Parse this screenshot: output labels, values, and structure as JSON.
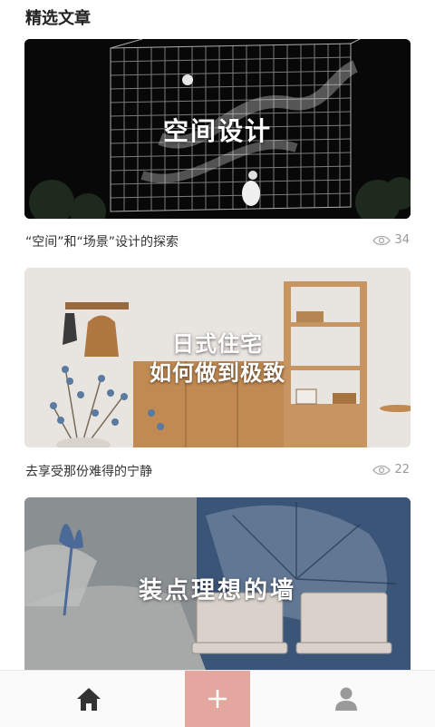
{
  "header": {
    "title": "精选文章"
  },
  "articles": [
    {
      "overlay_lines": [
        "空间设计"
      ],
      "title": "“空间”和“场景”设计的探索",
      "views": "34"
    },
    {
      "overlay_lines": [
        "日式住宅",
        "如何做到极致"
      ],
      "title": "去享受那份难得的宁静",
      "views": "22"
    },
    {
      "overlay_lines": [
        "装点理想的墙"
      ],
      "title": "",
      "views": ""
    }
  ],
  "tabbar": {
    "items": [
      {
        "icon": "home-icon"
      },
      {
        "icon": "plus-icon"
      },
      {
        "icon": "user-icon"
      }
    ],
    "accent": "#e3a79f"
  }
}
